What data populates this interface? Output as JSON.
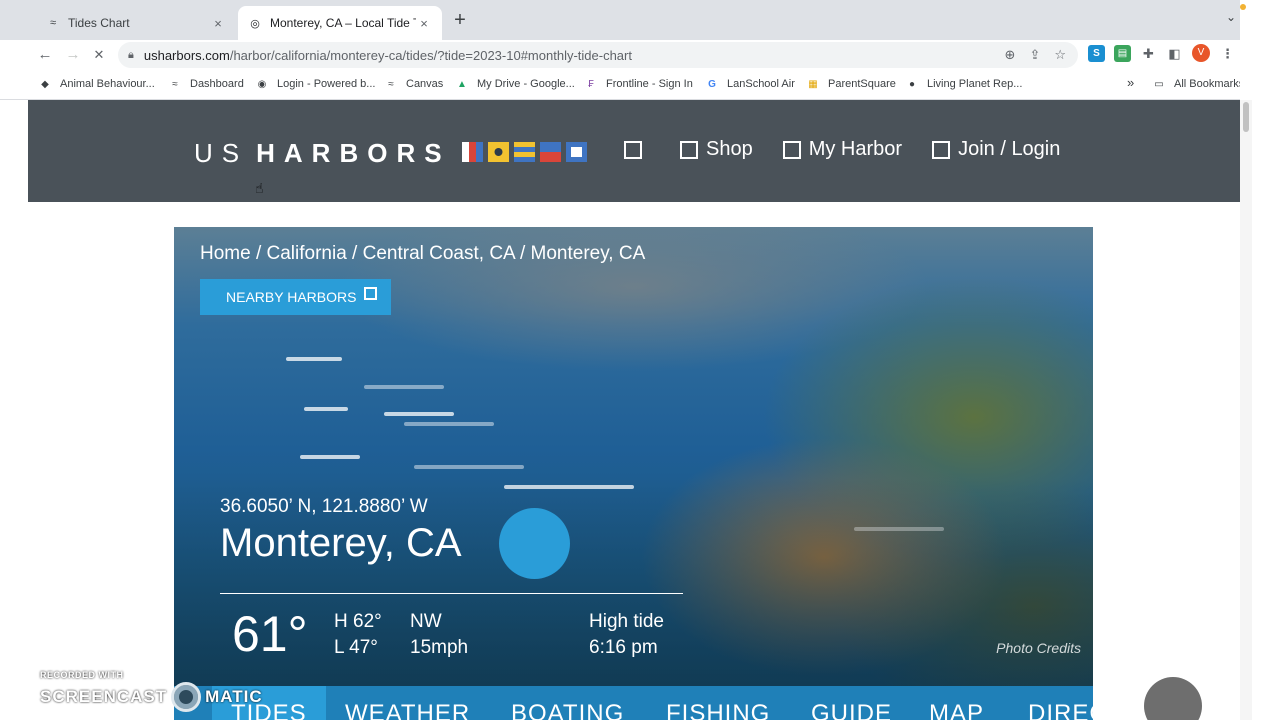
{
  "browser": {
    "tabs": [
      {
        "title": "Tides Chart",
        "close": "×"
      },
      {
        "title": "Monterey, CA – Local Tide Times",
        "close": "×"
      }
    ],
    "new_tab": "+",
    "tab_search": "⌄",
    "back": "←",
    "forward": "→",
    "reload": "✕",
    "url_host": "usharbors.com",
    "url_path": "/harbor/california/monterey-ca/tides/?tide=2023-10#monthly-tide-chart",
    "avatar_letter": "V",
    "bookmarks": [
      "Animal Behaviour...",
      "Dashboard",
      "Login - Powered b...",
      "Canvas",
      "My Drive - Google...",
      "Frontline - Sign In",
      "LanSchool Air",
      "ParentSquare",
      "Living Planet Rep..."
    ],
    "bookmarks_overflow": "»",
    "all_bookmarks": "All Bookmarks"
  },
  "site": {
    "logo_us": "US",
    "logo_harbors": "HARBORS",
    "nav": [
      "",
      "Shop",
      "My Harbor",
      "Join / Login"
    ],
    "breadcrumb": "Home / California / Central Coast, CA / Monterey, CA",
    "nearby_button": "NEARBY HARBORS",
    "coords": "36.6050’ N, 121.8880’ W",
    "city": "Monterey, CA",
    "temperature": "61°",
    "high": "H 62°",
    "low": "L 47°",
    "wind_dir": "NW",
    "wind_speed": "15mph",
    "tide_label": "High tide",
    "tide_time": "6:16 pm",
    "photo_credits": "Photo Credits",
    "tabs": [
      "TIDES",
      "WEATHER",
      "BOATING",
      "FISHING",
      "GUIDE",
      "MAP",
      "DIREC"
    ]
  },
  "watermark": {
    "recorded": "RECORDED WITH",
    "brand_left": "SCREENCAST",
    "brand_right": "MATIC"
  },
  "colors": {
    "header_bg": "#4a5259",
    "accent_blue": "#2a9dd8",
    "tabbar_blue": "#1f80b8"
  }
}
